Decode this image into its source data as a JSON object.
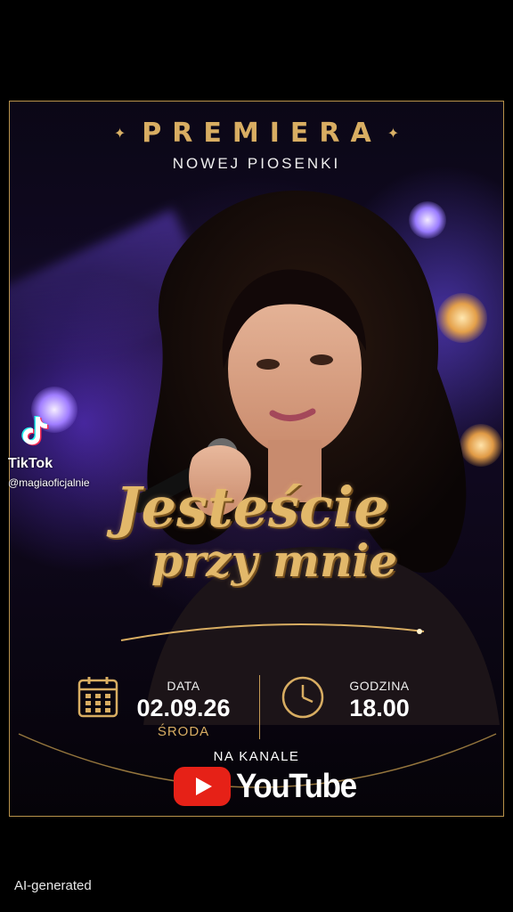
{
  "poster": {
    "heading": "PREMIERA",
    "subheading": "NOWEJ PIOSENKI",
    "song_title_line1": "Jesteście",
    "song_title_line2": "przy mnie",
    "date_label": "DATA",
    "date_value": "02.09.26",
    "weekday": "ŚRODA",
    "time_label": "GODZINA",
    "time_value": "18.00",
    "channel_label": "NA KANALE",
    "platform": "YouTube"
  },
  "overlay": {
    "app_name": "TikTok",
    "handle": "@magiaoficjalnie",
    "ai_label": "AI-generated"
  },
  "icons": {
    "calendar": "calendar-icon",
    "clock": "clock-icon",
    "youtube": "youtube-logo-icon",
    "tiktok": "tiktok-logo-icon"
  },
  "colors": {
    "gold": "#d8ad62",
    "background": "#000000",
    "youtube_red": "#e62117"
  }
}
